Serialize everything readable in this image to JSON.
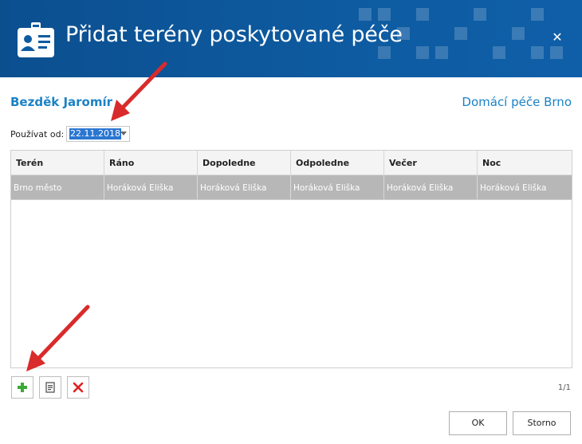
{
  "dialog": {
    "title": "Přidat terény poskytované péče",
    "close_glyph": "✕"
  },
  "patient": {
    "name": "Bezděk Jaromír"
  },
  "agency": {
    "name": "Domácí péče Brno"
  },
  "date_field": {
    "label": "Používat od:",
    "value": "22.11.2018"
  },
  "grid": {
    "columns": [
      "Terén",
      "Ráno",
      "Dopoledne",
      "Odpoledne",
      "Večer",
      "Noc"
    ],
    "rows": [
      [
        "Brno město",
        "Horáková Eliška",
        "Horáková Eliška",
        "Horáková Eliška",
        "Horáková Eliška",
        "Horáková Eliška"
      ]
    ]
  },
  "toolbar": {
    "add_icon": "plus-icon",
    "edit_icon": "edit-document-icon",
    "delete_icon": "delete-x-icon"
  },
  "pager": {
    "text": "1/1"
  },
  "buttons": {
    "ok": "OK",
    "cancel": "Storno"
  },
  "colors": {
    "header_bg": "#0e5ba1",
    "accent_text": "#1b82c6",
    "selected_row": "#b7b7b7",
    "add_green": "#3aa935",
    "delete_red": "#e02020",
    "annotation_arrow": "#d92b2b"
  }
}
